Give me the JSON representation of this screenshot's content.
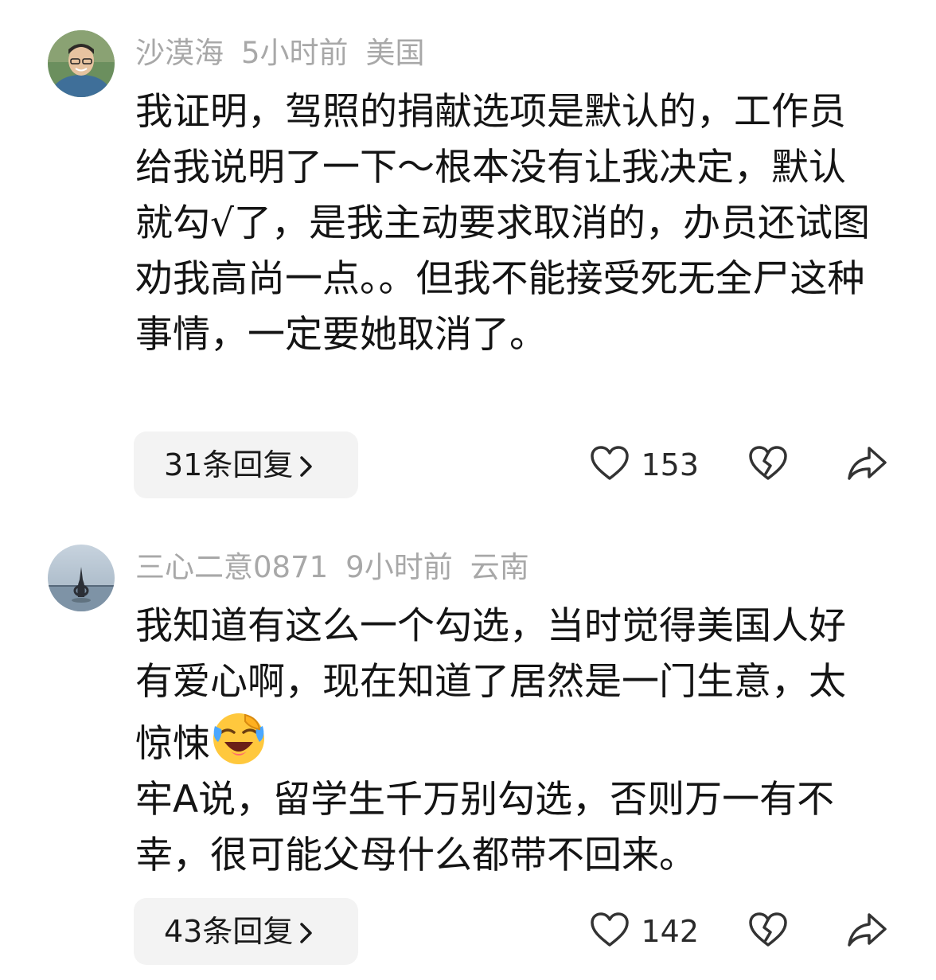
{
  "comments": [
    {
      "username": "沙漠海",
      "time": "5小时前",
      "location": "美国",
      "text": "我证明，驾照的捐献选项是默认的，工作员给我说明了一下～根本没有让我决定，默认就勾√了，是我主动要求取消的，办员还试图劝我高尚一点。。但我不能接受死无全尸这种事情，一定要她取消了。",
      "replies_label": "31条回复",
      "likes": "153"
    },
    {
      "username": "三心二意0871",
      "time": "9小时前",
      "location": "云南",
      "text_part1": "我知道有这么一个勾选，当时觉得美国人好有爱心啊，现在知道了居然是一门生意，太惊悚",
      "emoji": "laughing-crying-emoji",
      "text_part2": "\n牢A说，留学生千万别勾选，否则万一有不幸，很可能父母什么都带不回来。",
      "replies_label": "43条回复",
      "likes": "142"
    }
  ],
  "colors": {
    "meta_text": "#a8a8a8",
    "body_text": "#141414",
    "reply_bg": "#f3f3f3",
    "icon_stroke": "#333333"
  }
}
